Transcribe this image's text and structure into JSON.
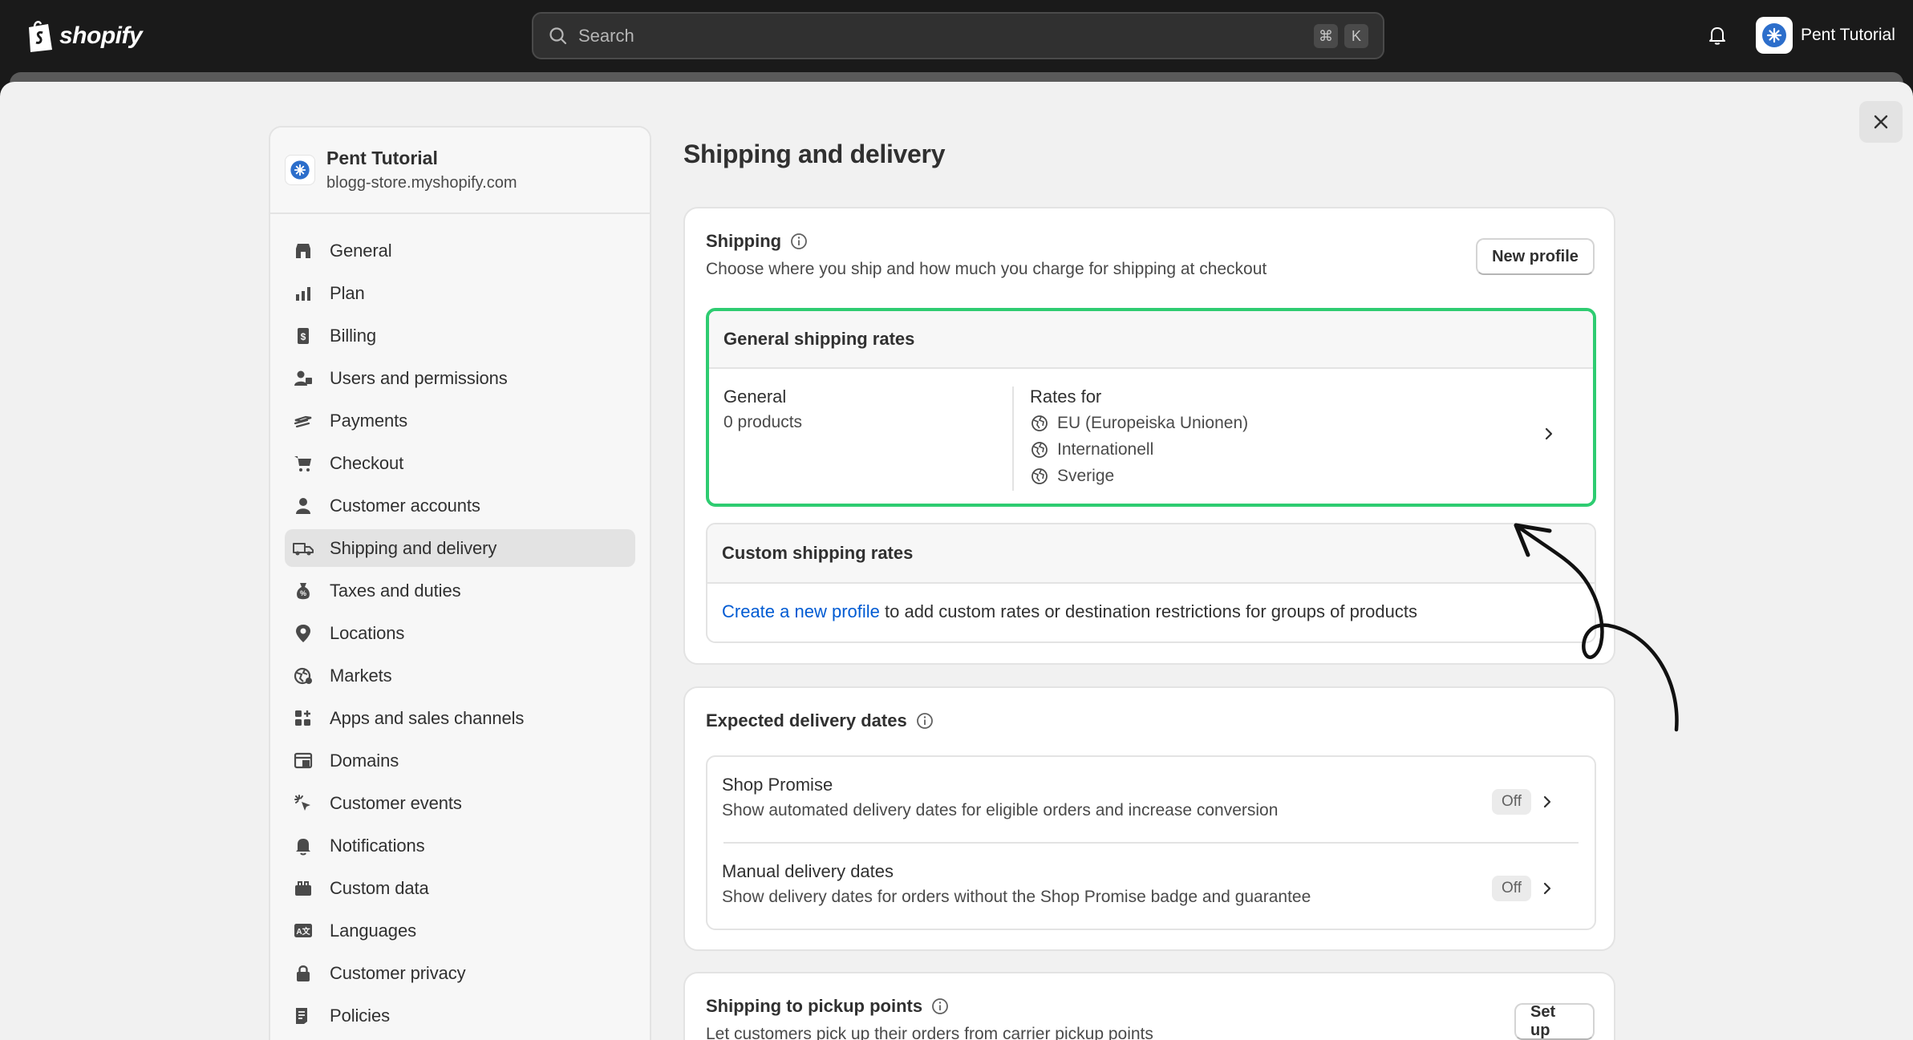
{
  "brand": {
    "logo_text": "shopify"
  },
  "search": {
    "placeholder": "Search",
    "shortcut_cmd": "⌘",
    "shortcut_key": "K"
  },
  "user": {
    "name": "Pent Tutorial"
  },
  "store": {
    "name": "Pent Tutorial",
    "domain": "blogg-store.myshopify.com"
  },
  "nav": [
    {
      "label": "General",
      "icon": "store-icon"
    },
    {
      "label": "Plan",
      "icon": "plan-icon"
    },
    {
      "label": "Billing",
      "icon": "billing-icon"
    },
    {
      "label": "Users and permissions",
      "icon": "users-icon"
    },
    {
      "label": "Payments",
      "icon": "payments-icon"
    },
    {
      "label": "Checkout",
      "icon": "cart-icon"
    },
    {
      "label": "Customer accounts",
      "icon": "person-icon"
    },
    {
      "label": "Shipping and delivery",
      "icon": "truck-icon",
      "active": true
    },
    {
      "label": "Taxes and duties",
      "icon": "taxes-icon"
    },
    {
      "label": "Locations",
      "icon": "location-pin-icon"
    },
    {
      "label": "Markets",
      "icon": "globe-icon"
    },
    {
      "label": "Apps and sales channels",
      "icon": "apps-icon"
    },
    {
      "label": "Domains",
      "icon": "domains-icon"
    },
    {
      "label": "Customer events",
      "icon": "cursor-click-icon"
    },
    {
      "label": "Notifications",
      "icon": "bell-icon"
    },
    {
      "label": "Custom data",
      "icon": "custom-data-icon"
    },
    {
      "label": "Languages",
      "icon": "language-icon"
    },
    {
      "label": "Customer privacy",
      "icon": "lock-icon"
    },
    {
      "label": "Policies",
      "icon": "policies-icon"
    }
  ],
  "page": {
    "title": "Shipping and delivery"
  },
  "shipping": {
    "title": "Shipping",
    "subtitle": "Choose where you ship and how much you charge for shipping at checkout",
    "new_profile_label": "New profile",
    "general_rates_title": "General shipping rates",
    "profile_name": "General",
    "profile_count": "0 products",
    "rates_for_label": "Rates for",
    "zones": [
      "EU (Europeiska Unionen)",
      "Internationell",
      "Sverige"
    ],
    "custom_rates_title": "Custom shipping rates",
    "custom_link": "Create a new profile",
    "custom_text": " to add custom rates or destination restrictions for groups of products"
  },
  "delivery": {
    "title": "Expected delivery dates",
    "rows": [
      {
        "title": "Shop Promise",
        "desc": "Show automated delivery dates for eligible orders and increase conversion",
        "status": "Off"
      },
      {
        "title": "Manual delivery dates",
        "desc": "Show delivery dates for orders without the Shop Promise badge and guarantee",
        "status": "Off"
      }
    ]
  },
  "pickup": {
    "title": "Shipping to pickup points",
    "subtitle": "Let customers pick up their orders from carrier pickup points",
    "setup_label": "Set up"
  },
  "colors": {
    "highlight_border": "#2ecc71",
    "link": "#005bd3",
    "topbar": "#1a1a1a"
  }
}
